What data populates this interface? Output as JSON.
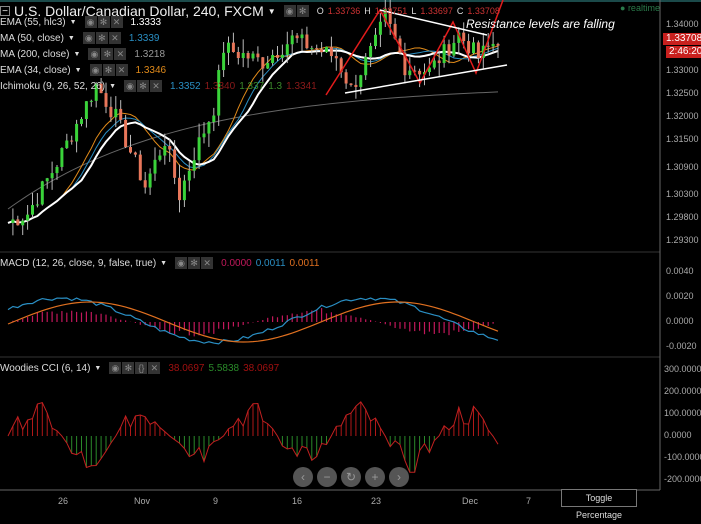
{
  "header": {
    "title": "U.S. Dollar/Canadian Dollar, 240, FXCM",
    "o_label": "O",
    "o": "1.33736",
    "h_label": "H",
    "h": "1.33751",
    "l_label": "L",
    "l": "1.33697",
    "c_label": "C",
    "c": "1.33708",
    "realtime": "realtime"
  },
  "indicators": [
    {
      "name": "EMA (55, hlc3)",
      "values": [
        {
          "v": "1.3333",
          "color": "#ffffff"
        }
      ]
    },
    {
      "name": "MA (50, close)",
      "values": [
        {
          "v": "1.3339",
          "color": "#2a8fc4"
        }
      ]
    },
    {
      "name": "MA (200, close)",
      "values": [
        {
          "v": "1.3218",
          "color": "#999999"
        }
      ]
    },
    {
      "name": "EMA (34, close)",
      "values": [
        {
          "v": "1.3346",
          "color": "#e08a1a"
        }
      ]
    },
    {
      "name": "Ichimoku (9, 26, 52, 26)",
      "values": [
        {
          "v": "1.3352",
          "color": "#2a8fc4"
        },
        {
          "v": "1.3340",
          "color": "#8b1a1a"
        },
        {
          "v": "1.337",
          "color": "#3a8a2a"
        },
        {
          "v": "1.3",
          "color": "#3a8a2a"
        },
        {
          "v": "1.3341",
          "color": "#8b1a1a"
        }
      ]
    }
  ],
  "macd": {
    "name": "MACD (12, 26, close, 9, false, true)",
    "values": [
      {
        "v": "0.0000",
        "color": "#c2185b"
      },
      {
        "v": "0.0011",
        "color": "#2a8fc4"
      },
      {
        "v": "0.0011",
        "color": "#e07020"
      }
    ],
    "ticks": [
      "0.0040",
      "0.0020",
      "0.0000",
      "-0.0020"
    ]
  },
  "cci": {
    "name": "Woodies CCI (6, 14)",
    "values": [
      {
        "v": "38.0697",
        "color": "#a01010"
      },
      {
        "v": "5.5838",
        "color": "#2a8a2a"
      },
      {
        "v": "38.0697",
        "color": "#a01010"
      }
    ],
    "ticks": [
      "300.0000",
      "200.0000",
      "100.0000",
      "0.0000",
      "-100.0000",
      "-200.0000"
    ]
  },
  "annotation": "Resistance levels are falling",
  "price_axis": {
    "ticks": [
      "1.34000",
      "1.33000",
      "1.32500",
      "1.32000",
      "1.31500",
      "1.30900",
      "1.30300",
      "1.29800",
      "1.29300"
    ],
    "last_price": "1.33708",
    "countdown": "2:46:20"
  },
  "x_axis": [
    "26",
    "Nov",
    "9",
    "16",
    "23",
    "Dec",
    "7"
  ],
  "nav_buttons": [
    "‹",
    "−",
    "↻",
    "+",
    "›"
  ],
  "toggle_percentage": "Toggle Percentage",
  "chart_data": {
    "type": "candlestick",
    "symbol": "USDCAD",
    "timeframe": "240",
    "close_keypoints": [
      [
        0,
        1.297
      ],
      [
        4,
        1.299
      ],
      [
        10,
        1.31
      ],
      [
        18,
        1.327
      ],
      [
        22,
        1.32
      ],
      [
        28,
        1.305
      ],
      [
        32,
        1.315
      ],
      [
        35,
        1.303
      ],
      [
        38,
        1.312
      ],
      [
        42,
        1.322
      ],
      [
        44,
        1.335
      ],
      [
        52,
        1.332
      ],
      [
        58,
        1.337
      ],
      [
        67,
        1.333
      ],
      [
        70,
        1.326
      ],
      [
        75,
        1.336
      ],
      [
        77,
        1.342
      ],
      [
        81,
        1.331
      ],
      [
        86,
        1.33
      ],
      [
        92,
        1.338
      ],
      [
        96,
        1.333
      ],
      [
        100,
        1.337
      ]
    ]
  }
}
